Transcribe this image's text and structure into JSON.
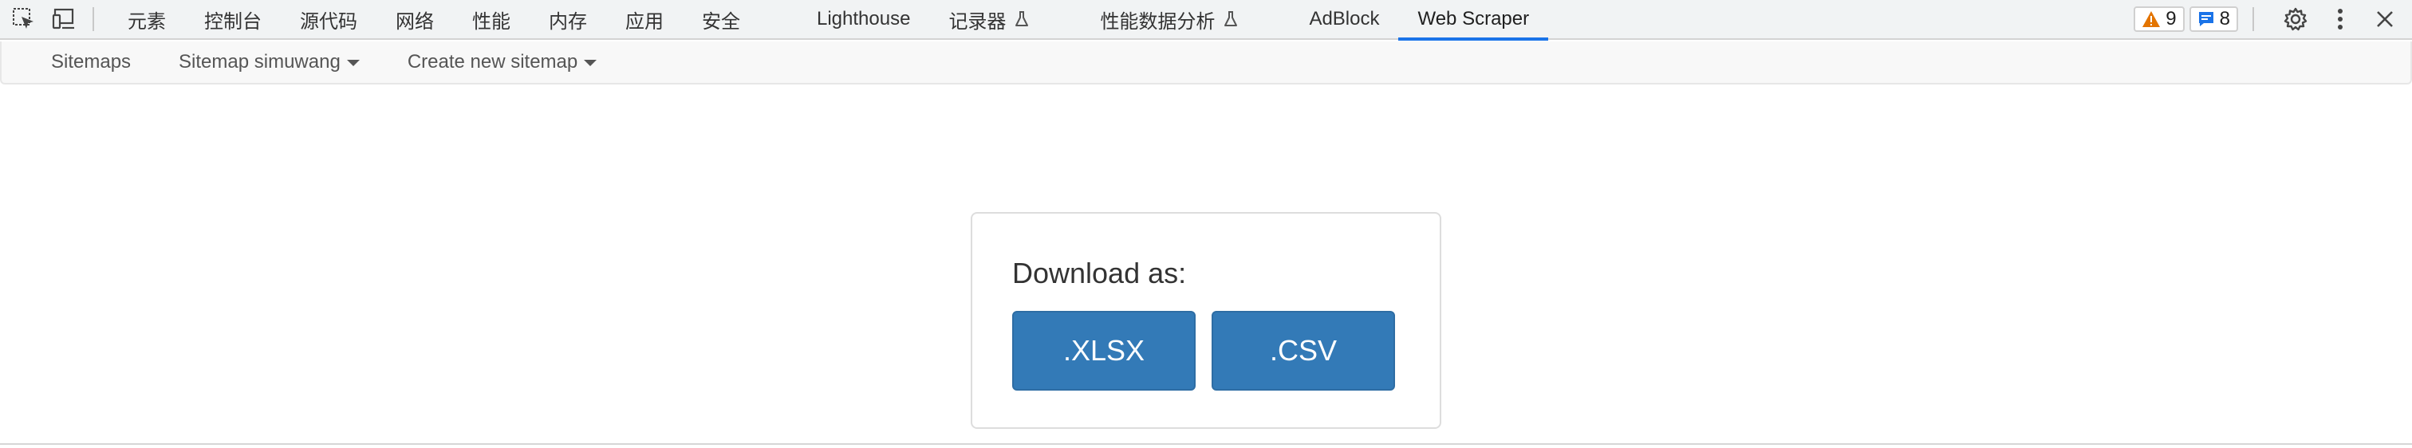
{
  "devtools": {
    "tabs": [
      {
        "label": "元素"
      },
      {
        "label": "控制台"
      },
      {
        "label": "源代码"
      },
      {
        "label": "网络"
      },
      {
        "label": "性能"
      },
      {
        "label": "内存"
      },
      {
        "label": "应用"
      },
      {
        "label": "安全"
      },
      {
        "label": "Lighthouse"
      },
      {
        "label": "记录器"
      },
      {
        "label": "性能数据分析"
      },
      {
        "label": "AdBlock"
      },
      {
        "label": "Web Scraper",
        "active": true
      }
    ],
    "warnings_count": "9",
    "messages_count": "8",
    "icons": {
      "inspect": "inspect-element-icon",
      "device": "device-toolbar-icon",
      "warning": "warning-triangle-icon",
      "message": "message-icon",
      "settings": "gear-icon",
      "more": "more-vertical-icon",
      "close": "close-icon",
      "flask": "flask-icon"
    },
    "colors": {
      "active_tab_underline": "#1a73e8",
      "warning": "#e37400",
      "message": "#1a73e8"
    }
  },
  "scraper_nav": {
    "sitemaps": "Sitemaps",
    "sitemap_current": "Sitemap simuwang",
    "create_new": "Create new sitemap"
  },
  "download": {
    "title": "Download as:",
    "xlsx": ".XLSX",
    "csv": ".CSV",
    "button_color": "#337ab7"
  }
}
